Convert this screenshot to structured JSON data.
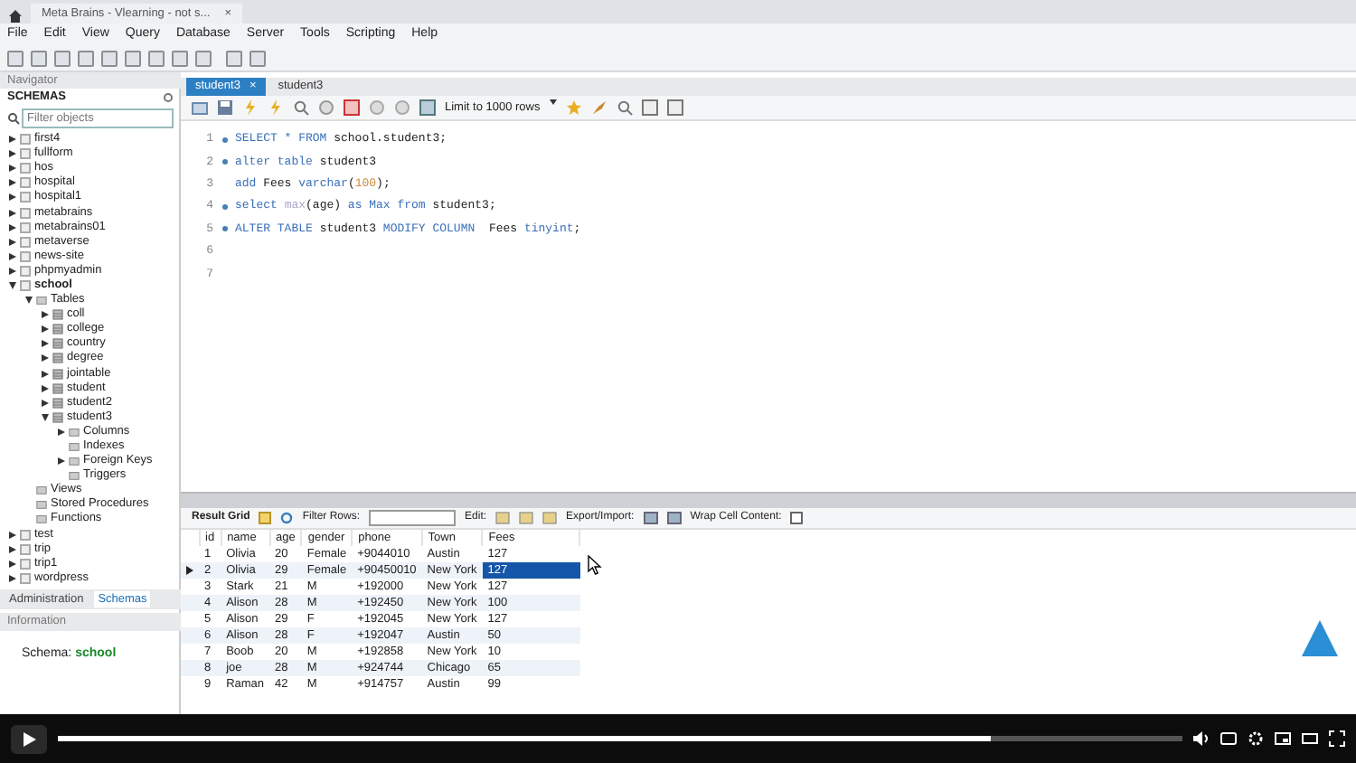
{
  "window": {
    "tab_title": "Meta Brains - Vlearning - not s...",
    "close": "×"
  },
  "menu": [
    "File",
    "Edit",
    "View",
    "Query",
    "Database",
    "Server",
    "Tools",
    "Scripting",
    "Help"
  ],
  "navigator": {
    "title": "Navigator",
    "schemas_label": "SCHEMAS",
    "filter": {
      "placeholder": "Filter objects"
    },
    "tree": [
      {
        "label": "first4",
        "kind": "schema",
        "expanded": false,
        "default": false
      },
      {
        "label": "fullform",
        "kind": "schema",
        "expanded": false,
        "default": false
      },
      {
        "label": "hos",
        "kind": "schema",
        "expanded": false,
        "default": false
      },
      {
        "label": "hospital",
        "kind": "schema",
        "expanded": false,
        "default": false
      },
      {
        "label": "hospital1",
        "kind": "schema",
        "expanded": false,
        "default": false
      },
      {
        "label": "metabrains",
        "kind": "schema",
        "expanded": false,
        "default": false
      },
      {
        "label": "metabrains01",
        "kind": "schema",
        "expanded": false,
        "default": false
      },
      {
        "label": "metaverse",
        "kind": "schema",
        "expanded": false,
        "default": false
      },
      {
        "label": "news-site",
        "kind": "schema",
        "expanded": false,
        "default": false
      },
      {
        "label": "phpmyadmin",
        "kind": "schema",
        "expanded": false,
        "default": false
      },
      {
        "label": "school",
        "kind": "schema",
        "expanded": true,
        "default": true,
        "children": [
          {
            "label": "Tables",
            "kind": "folder",
            "expanded": true,
            "children": [
              {
                "label": "coll",
                "kind": "table",
                "expanded": false
              },
              {
                "label": "college",
                "kind": "table",
                "expanded": false
              },
              {
                "label": "country",
                "kind": "table",
                "expanded": false
              },
              {
                "label": "degree",
                "kind": "table",
                "expanded": false
              },
              {
                "label": "jointable",
                "kind": "table",
                "expanded": false
              },
              {
                "label": "student",
                "kind": "table",
                "expanded": false
              },
              {
                "label": "student2",
                "kind": "table",
                "expanded": false
              },
              {
                "label": "student3",
                "kind": "table",
                "expanded": true,
                "children": [
                  {
                    "label": "Columns",
                    "kind": "folder",
                    "expanded": false
                  },
                  {
                    "label": "Indexes",
                    "kind": "folder"
                  },
                  {
                    "label": "Foreign Keys",
                    "kind": "folder",
                    "expanded": false
                  },
                  {
                    "label": "Triggers",
                    "kind": "folder"
                  }
                ]
              }
            ]
          },
          {
            "label": "Views",
            "kind": "folder"
          },
          {
            "label": "Stored Procedures",
            "kind": "folder"
          },
          {
            "label": "Functions",
            "kind": "folder"
          }
        ]
      },
      {
        "label": "test",
        "kind": "schema",
        "expanded": false,
        "default": false
      },
      {
        "label": "trip",
        "kind": "schema",
        "expanded": false,
        "default": false
      },
      {
        "label": "trip1",
        "kind": "schema",
        "expanded": false,
        "default": false
      },
      {
        "label": "wordpress",
        "kind": "schema",
        "expanded": false,
        "default": false
      }
    ],
    "bottom_tabs": [
      {
        "label": "Administration",
        "selected": false
      },
      {
        "label": "Schemas",
        "selected": true
      }
    ],
    "info_title": "Information",
    "schema_label": "Schema:",
    "schema_value": "school"
  },
  "editor": {
    "tabs": [
      {
        "label": "student3",
        "selected": true,
        "close": "×"
      },
      {
        "label": "student3",
        "selected": false
      }
    ],
    "limit": "Limit to 1000 rows",
    "lines": [
      {
        "number": "1",
        "marker": true,
        "tokens": [
          {
            "text": "SELECT * FROM ",
            "kind": "keyword"
          },
          {
            "text": "school.student3;",
            "kind": "plain"
          }
        ]
      },
      {
        "number": "2",
        "marker": true,
        "tokens": [
          {
            "text": "alter table ",
            "kind": "keyword"
          },
          {
            "text": "student3",
            "kind": "plain"
          }
        ]
      },
      {
        "number": "3",
        "marker": false,
        "tokens": [
          {
            "text": "add ",
            "kind": "keyword"
          },
          {
            "text": "Fees ",
            "kind": "plain"
          },
          {
            "text": "varchar",
            "kind": "keyword"
          },
          {
            "text": "(",
            "kind": "plain"
          },
          {
            "text": "100",
            "kind": "number"
          },
          {
            "text": ");",
            "kind": "plain"
          }
        ]
      },
      {
        "number": "4",
        "marker": true,
        "tokens": [
          {
            "text": "select ",
            "kind": "keyword"
          },
          {
            "text": "max",
            "kind": "function"
          },
          {
            "text": "(age) ",
            "kind": "plain"
          },
          {
            "text": "as Max from ",
            "kind": "keyword"
          },
          {
            "text": "student3;",
            "kind": "plain"
          }
        ]
      },
      {
        "number": "5",
        "marker": true,
        "tokens": [
          {
            "text": "ALTER TABLE ",
            "kind": "keyword"
          },
          {
            "text": "student3 ",
            "kind": "plain"
          },
          {
            "text": "MODIFY COLUMN  ",
            "kind": "keyword"
          },
          {
            "text": "Fees ",
            "kind": "plain"
          },
          {
            "text": "tinyint",
            "kind": "keyword"
          },
          {
            "text": ";",
            "kind": "plain"
          }
        ]
      },
      {
        "number": "6",
        "marker": false
      },
      {
        "number": "7",
        "marker": false
      }
    ]
  },
  "result": {
    "toolbar": {
      "result_grid": "Result Grid",
      "filter_label": "Filter Rows:",
      "edit_label": "Edit:",
      "export_label": "Export/Import:",
      "wrap_label": "Wrap Cell Content:"
    },
    "columns": [
      "id",
      "name",
      "age",
      "gender",
      "phone",
      "Town",
      "Fees"
    ],
    "rows": [
      {
        "cells": [
          "1",
          "Olivia",
          "20",
          "Female",
          "+9044010",
          "Austin",
          "127"
        ],
        "selected": false
      },
      {
        "cells": [
          "2",
          "Olivia",
          "29",
          "Female",
          "+90450010",
          "New York",
          "127"
        ],
        "selected": true
      },
      {
        "cells": [
          "3",
          "Stark",
          "21",
          "M",
          "+192000",
          "New York",
          "127"
        ],
        "selected": false
      },
      {
        "cells": [
          "4",
          "Alison",
          "28",
          "M",
          "+192450",
          "New York",
          "100"
        ],
        "selected": false
      },
      {
        "cells": [
          "5",
          "Alison",
          "29",
          "F",
          "+192045",
          "New York",
          "127"
        ],
        "selected": false
      },
      {
        "cells": [
          "6",
          "Alison",
          "28",
          "F",
          "+192047",
          "Austin",
          "50"
        ],
        "selected": false
      },
      {
        "cells": [
          "7",
          "Boob",
          "20",
          "M",
          "+192858",
          "New York",
          "10"
        ],
        "selected": false
      },
      {
        "cells": [
          "8",
          "joe",
          "28",
          "M",
          "+924744",
          "Chicago",
          "65"
        ],
        "selected": false
      },
      {
        "cells": [
          "9",
          "Raman",
          "42",
          "M",
          "+914757",
          "Austin",
          "99"
        ],
        "selected": false
      }
    ]
  },
  "player": {
    "progress": {
      "level": 0.83
    }
  }
}
